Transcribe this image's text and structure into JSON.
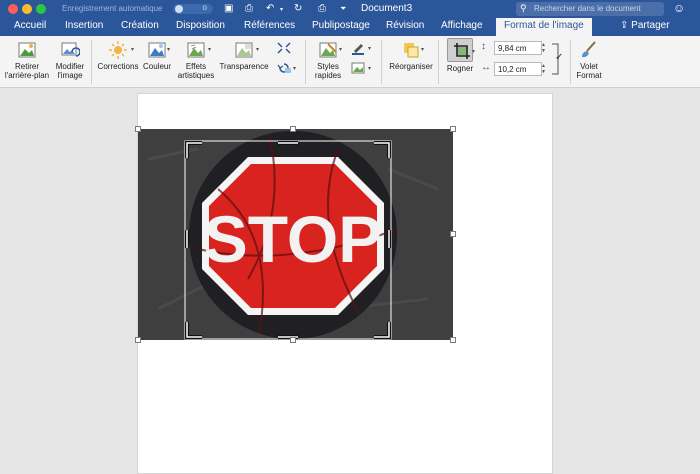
{
  "titlebar": {
    "autosave_label": "Enregistrement automatique",
    "autosave_state": "o",
    "document_title": "Document3",
    "search_placeholder": "Rechercher dans le document"
  },
  "tabs": [
    {
      "label": "Accueil"
    },
    {
      "label": "Insertion"
    },
    {
      "label": "Création"
    },
    {
      "label": "Disposition"
    },
    {
      "label": "Références"
    },
    {
      "label": "Publipostage"
    },
    {
      "label": "Révision"
    },
    {
      "label": "Affichage"
    },
    {
      "label": "Format de l'image",
      "active": true
    }
  ],
  "share_label": "Partager",
  "ribbon": {
    "remove_background": {
      "line1": "Retirer",
      "line2": "l'arrière-plan"
    },
    "change_picture": {
      "line1": "Modifier",
      "line2": "l'image"
    },
    "corrections": "Corrections",
    "color": "Couleur",
    "artistic_effects": {
      "line1": "Effets",
      "line2": "artistiques"
    },
    "transparency": "Transparence",
    "quick_styles": {
      "line1": "Styles",
      "line2": "rapides"
    },
    "arrange": "Réorganiser",
    "crop": "Rogner",
    "height_value": "9,84 cm",
    "width_value": "10,2 cm",
    "format_pane": {
      "line1": "Volet",
      "line2": "Format"
    }
  },
  "image": {
    "sign_text": "STOP"
  },
  "colors": {
    "accent": "#2b579a",
    "sign_red": "#d8231f",
    "image_bg": "#3f3f40"
  }
}
